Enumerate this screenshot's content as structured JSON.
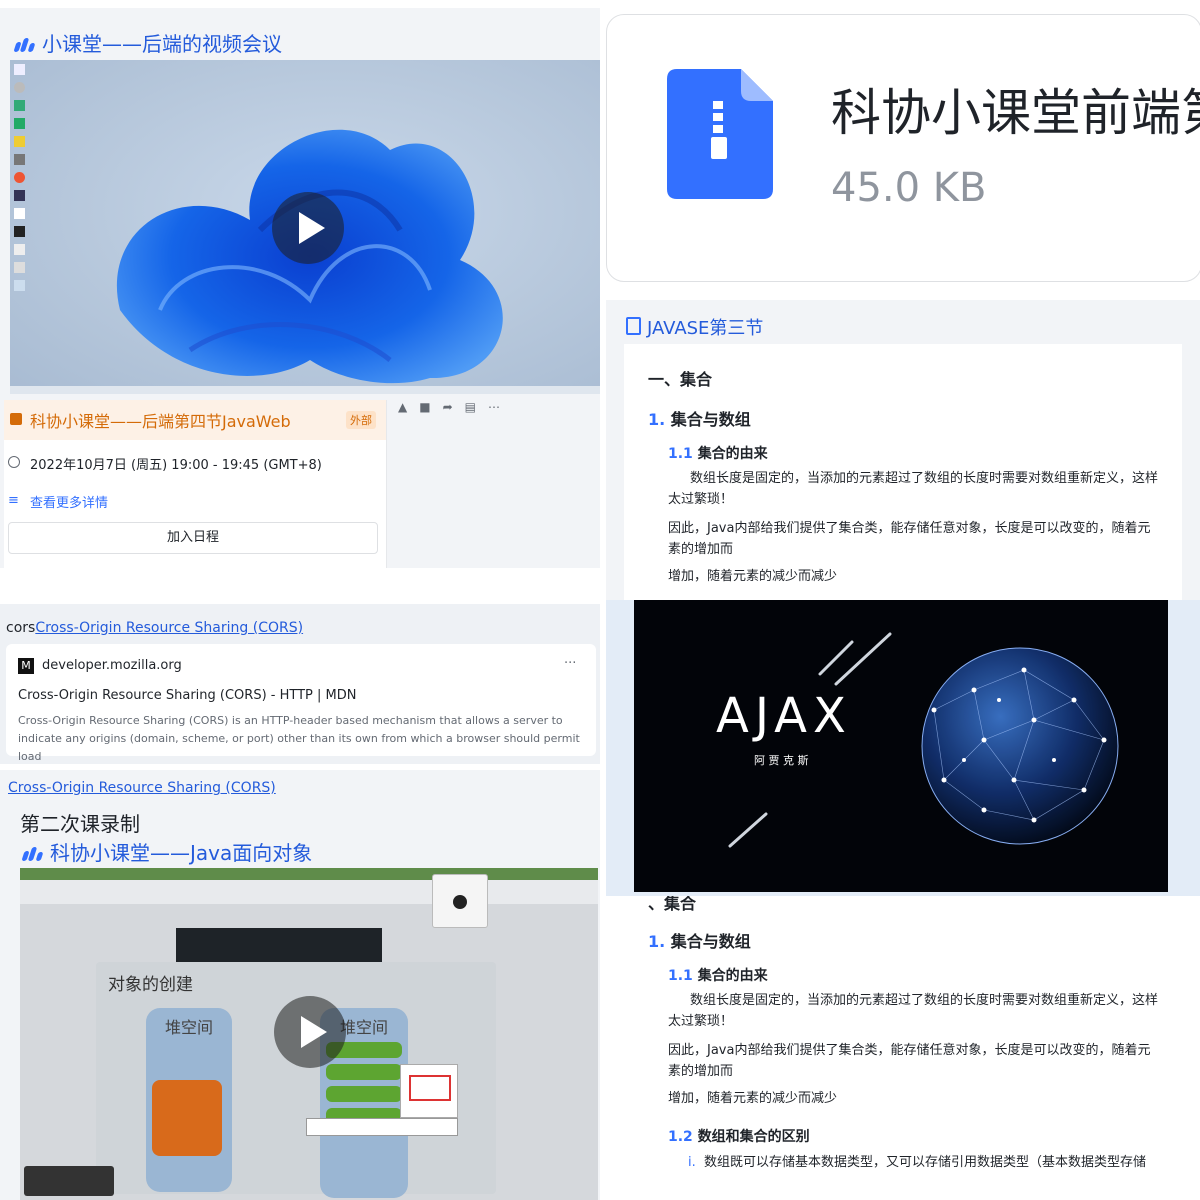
{
  "video1": {
    "title": "小课堂——后端的视频会议",
    "event_title": "科协小课堂——后端第四节JavaWeb",
    "external_badge": "外部",
    "time": "2022年10月7日 (周五) 19:00 - 19:45 (GMT+8)",
    "more_details": "查看更多详情",
    "add_calendar": "加入日程"
  },
  "file_card": {
    "name": "科协小课堂前端第",
    "size": "45.0 KB"
  },
  "doc1": {
    "title": "JAVASE第三节",
    "h1": "一、集合",
    "h2_num": "1.",
    "h2": "集合与数组",
    "h3_num": "1.1",
    "h3": "集合的由来",
    "p1": "数组长度是固定的，当添加的元素超过了数组的长度时需要对数组重新定义，这样太过繁琐！",
    "p2": "因此，Java内部给我们提供了集合类，能存储任意对象，长度是可以改变的，随着元素的增加而",
    "p3": "增加，随着元素的减少而减少"
  },
  "cors": {
    "prefix": "cors",
    "link_text": "Cross-Origin Resource Sharing (CORS)",
    "domain": "developer.mozilla.org",
    "more": "···",
    "preview_title": "Cross-Origin Resource Sharing (CORS) - HTTP | MDN",
    "preview_desc": "Cross-Origin Resource Sharing (CORS) is an HTTP-header based mechanism that allows a server to indicate any origins (domain, scheme, or port) other than its own from which a browser should permit load",
    "link2": "Cross-Origin Resource Sharing (CORS)"
  },
  "video2": {
    "heading": "第二次课录制",
    "title": "科协小课堂——Java面向对象",
    "slide_title": "对象的创建",
    "stack_label": "堆空间",
    "heap_label": "堆空间"
  },
  "ajax": {
    "title": "AJAX",
    "subtitle": "阿 贾 克 斯"
  },
  "doc2": {
    "h1_partial": "、集合",
    "h2_num": "1.",
    "h2": "集合与数组",
    "h3_num": "1.1",
    "h3": "集合的由来",
    "p1": "数组长度是固定的，当添加的元素超过了数组的长度时需要对数组重新定义，这样太过繁琐！",
    "p2": "因此，Java内部给我们提供了集合类，能存储任意对象，长度是可以改变的，随着元素的增加而",
    "p3": "增加，随着元素的减少而减少",
    "h3b_num": "1.2",
    "h3b": "数组和集合的区别",
    "li_num": "i.",
    "li": "数组既可以存储基本数据类型，又可以存储引用数据类型（基本数据类型存储"
  },
  "colors": {
    "accent": "#3370ff",
    "link": "#245bdb",
    "event_bg": "#fdf1e6",
    "event_text": "#d46b08"
  }
}
